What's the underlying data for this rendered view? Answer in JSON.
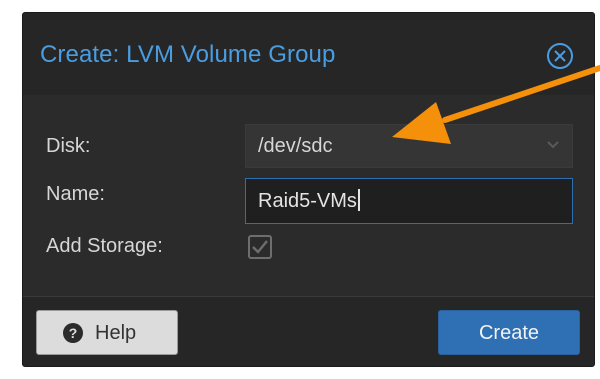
{
  "dialog": {
    "title": "Create: LVM Volume Group",
    "close_icon": "close-circle-icon"
  },
  "form": {
    "disk_label": "Disk:",
    "disk_value": "/dev/sdc",
    "disk_dropdown_icon": "chevron-down-icon",
    "name_label": "Name:",
    "name_value": "Raid5-VMs",
    "add_storage_label": "Add Storage:",
    "add_storage_checked": true
  },
  "footer": {
    "help_label": "Help",
    "help_icon": "question-circle-icon",
    "create_label": "Create"
  },
  "annotation": {
    "arrow_icon": "arrow-icon",
    "arrow_color": "#f5900a"
  },
  "colors": {
    "title": "#4a9de0",
    "primary_button": "#2f6fb3",
    "dialog_background": "#2b2b2b"
  }
}
